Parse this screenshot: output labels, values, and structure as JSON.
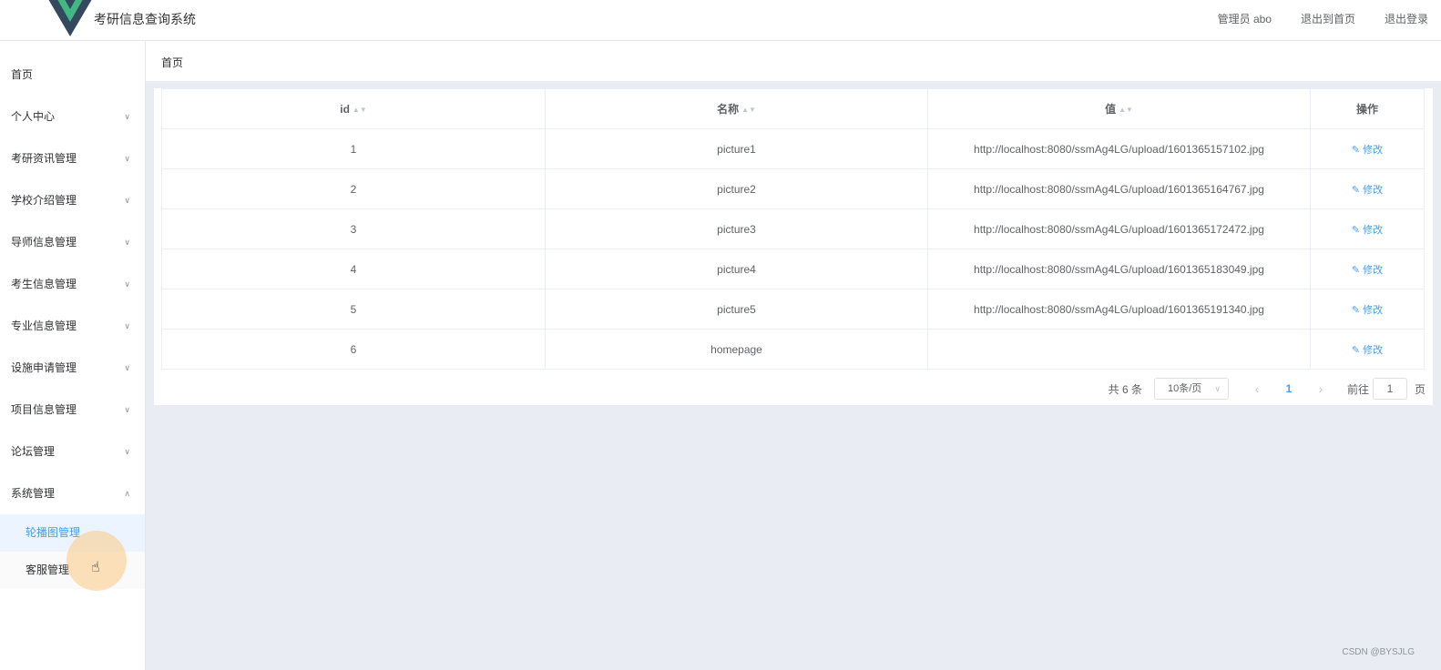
{
  "header": {
    "app_title": "考研信息查询系统",
    "user_label": "管理员 abo",
    "home_link": "退出到首页",
    "logout_link": "退出登录"
  },
  "sidebar": {
    "home": "首页",
    "items": [
      {
        "label": "个人中心"
      },
      {
        "label": "考研资讯管理"
      },
      {
        "label": "学校介绍管理"
      },
      {
        "label": "导师信息管理"
      },
      {
        "label": "考生信息管理"
      },
      {
        "label": "专业信息管理"
      },
      {
        "label": "设施申请管理"
      },
      {
        "label": "项目信息管理"
      },
      {
        "label": "论坛管理"
      },
      {
        "label": "系统管理"
      }
    ],
    "system_sub": [
      "轮播图管理",
      "客服管理"
    ]
  },
  "breadcrumb": "首页",
  "table": {
    "headers": [
      "id",
      "名称",
      "值",
      "操作"
    ],
    "edit_label": "修改",
    "rows": [
      {
        "id": "1",
        "name": "picture1",
        "value": "http://localhost:8080/ssmAg4LG/upload/1601365157102.jpg"
      },
      {
        "id": "2",
        "name": "picture2",
        "value": "http://localhost:8080/ssmAg4LG/upload/1601365164767.jpg"
      },
      {
        "id": "3",
        "name": "picture3",
        "value": "http://localhost:8080/ssmAg4LG/upload/1601365172472.jpg"
      },
      {
        "id": "4",
        "name": "picture4",
        "value": "http://localhost:8080/ssmAg4LG/upload/1601365183049.jpg"
      },
      {
        "id": "5",
        "name": "picture5",
        "value": "http://localhost:8080/ssmAg4LG/upload/1601365191340.jpg"
      },
      {
        "id": "6",
        "name": "homepage",
        "value": ""
      }
    ]
  },
  "pagination": {
    "total": "共 6 条",
    "page_size": "10条/页",
    "current_page": "1",
    "goto_label": "前往",
    "goto_value": "1",
    "page_unit": "页"
  },
  "watermark": "CSDN @BYSJLG",
  "colors": {
    "accent": "#409eff",
    "logo_dark": "#35495e",
    "logo_green": "#41b883",
    "content_bg": "#e9edf3"
  }
}
